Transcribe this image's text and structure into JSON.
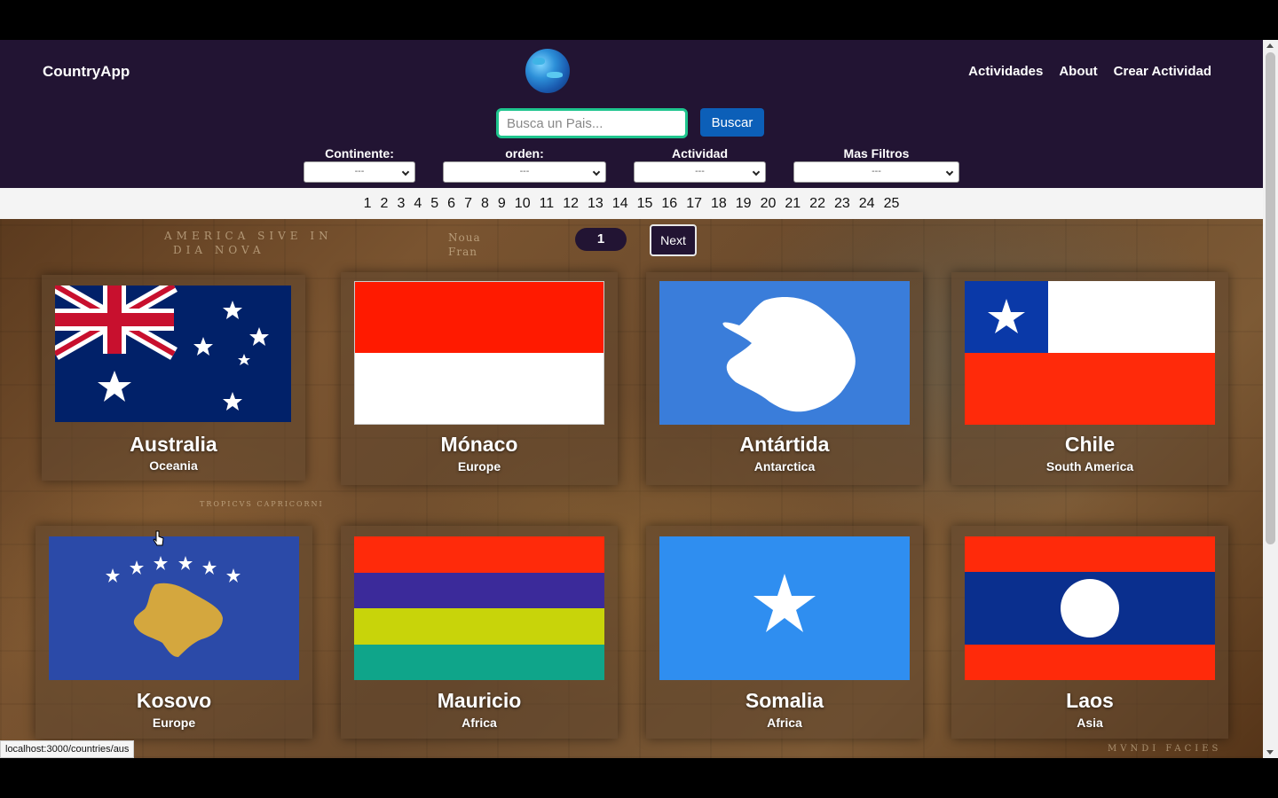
{
  "header": {
    "brand": "CountryApp",
    "nav": [
      "Actividades",
      "About",
      "Crear Actividad"
    ],
    "search_placeholder": "Busca un Pais...",
    "search_button": "Buscar"
  },
  "filters": [
    {
      "label": "Continente:",
      "value": "---"
    },
    {
      "label": "orden:",
      "value": "---"
    },
    {
      "label": "Actividad",
      "value": "---"
    },
    {
      "label": "Mas Filtros",
      "value": "---"
    }
  ],
  "pagination": {
    "pages": [
      "1",
      "2",
      "3",
      "4",
      "5",
      "6",
      "7",
      "8",
      "9",
      "10",
      "11",
      "12",
      "13",
      "14",
      "15",
      "16",
      "17",
      "18",
      "19",
      "20",
      "21",
      "22",
      "23",
      "24",
      "25"
    ],
    "current": "1",
    "next_label": "Next"
  },
  "map_labels": [
    "AMERICA SIVE IN",
    "DIA NOVA",
    "Noua",
    "Fran",
    "TROPICVS CAPRICORNI",
    "MVNDI FACIES"
  ],
  "countries": [
    {
      "name": "Australia",
      "continent": "Oceania",
      "flag": "australia-flag-icon"
    },
    {
      "name": "Mónaco",
      "continent": "Europe",
      "flag": "monaco-flag-icon"
    },
    {
      "name": "Antártida",
      "continent": "Antarctica",
      "flag": "antarctica-flag-icon"
    },
    {
      "name": "Chile",
      "continent": "South America",
      "flag": "chile-flag-icon"
    },
    {
      "name": "Kosovo",
      "continent": "Europe",
      "flag": "kosovo-flag-icon"
    },
    {
      "name": "Mauricio",
      "continent": "Africa",
      "flag": "mauritius-flag-icon"
    },
    {
      "name": "Somalia",
      "continent": "Africa",
      "flag": "somalia-flag-icon"
    },
    {
      "name": "Laos",
      "continent": "Asia",
      "flag": "laos-flag-icon"
    }
  ],
  "status_bar": {
    "url": "localhost:3000/countries/aus"
  },
  "colors": {
    "header_bg": "#221433",
    "accent_button": "#0c5fb8",
    "search_border": "#1fc58e"
  }
}
